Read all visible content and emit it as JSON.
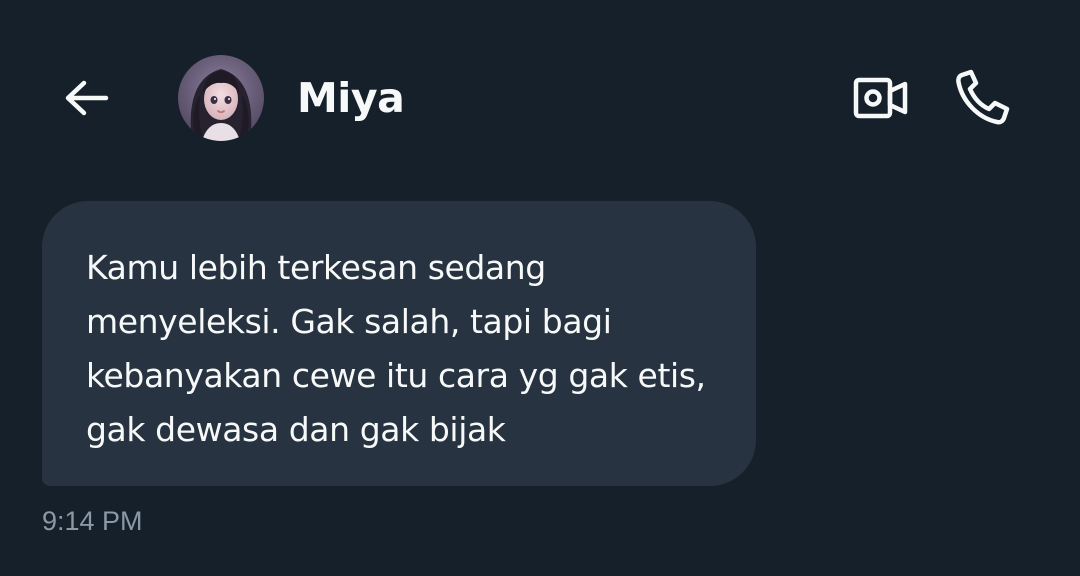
{
  "header": {
    "back_icon": "arrow-left-icon",
    "contact_name": "Miya",
    "video_icon": "video-camera-icon",
    "call_icon": "phone-icon"
  },
  "conversation": {
    "messages": [
      {
        "text": "Kamu lebih terkesan sedang menyeleksi. Gak salah, tapi bagi kebanyakan cewe itu cara yg gak etis, gak dewasa dan gak bijak",
        "time": "9:14 PM"
      }
    ]
  },
  "colors": {
    "background": "#15202b",
    "bubble": "#273340",
    "text": "#f7f9f9",
    "muted": "#8b98a5"
  }
}
